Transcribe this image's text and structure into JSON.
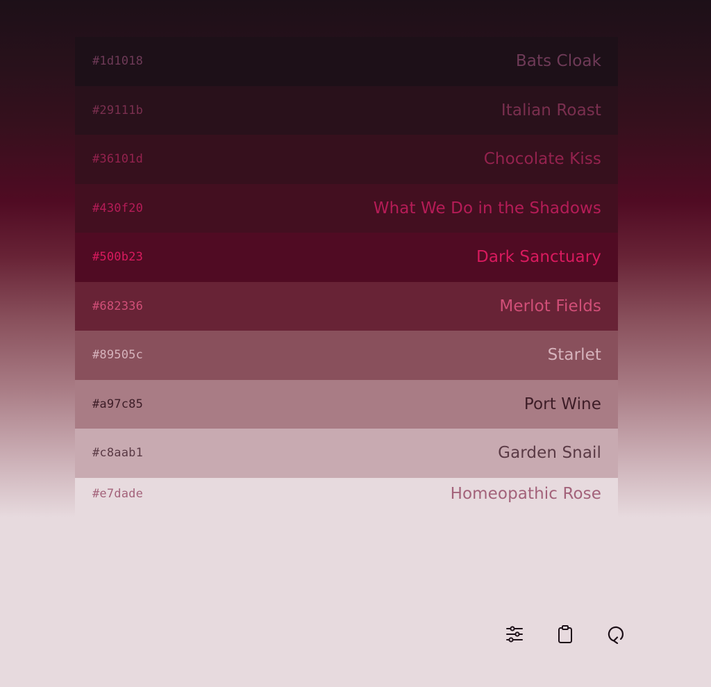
{
  "palette": [
    {
      "hex": "#1d1018",
      "name": "Bats Cloak",
      "bg": "#1d1018",
      "fg": "#6e3a57"
    },
    {
      "hex": "#29111b",
      "name": "Italian Roast",
      "bg": "#29111b",
      "fg": "#7a2f4f"
    },
    {
      "hex": "#36101d",
      "name": "Chocolate Kiss",
      "bg": "#36101d",
      "fg": "#94224e"
    },
    {
      "hex": "#430f20",
      "name": "What We Do in the Shadows",
      "bg": "#430f20",
      "fg": "#b51c57"
    },
    {
      "hex": "#500b23",
      "name": "Dark Sanctuary",
      "bg": "#500b23",
      "fg": "#d81a5e"
    },
    {
      "hex": "#682336",
      "name": "Merlot Fields",
      "bg": "#682336",
      "fg": "#d14f78"
    },
    {
      "hex": "#89505c",
      "name": "Starlet",
      "bg": "#89505c",
      "fg": "#d6b3bc"
    },
    {
      "hex": "#a97c85",
      "name": "Port Wine",
      "bg": "#a97c85",
      "fg": "#3d1d27"
    },
    {
      "hex": "#c8aab1",
      "name": "Garden Snail",
      "bg": "#c8aab1",
      "fg": "#5a3a45"
    },
    {
      "hex": "#e7dade",
      "name": "Homeopathic Rose",
      "bg": "#e7dade",
      "fg": "#a3627a"
    }
  ],
  "toolbar": {
    "icons": [
      "sliders-icon",
      "clipboard-icon",
      "refresh-icon"
    ],
    "icon_color": "#1d1018"
  }
}
